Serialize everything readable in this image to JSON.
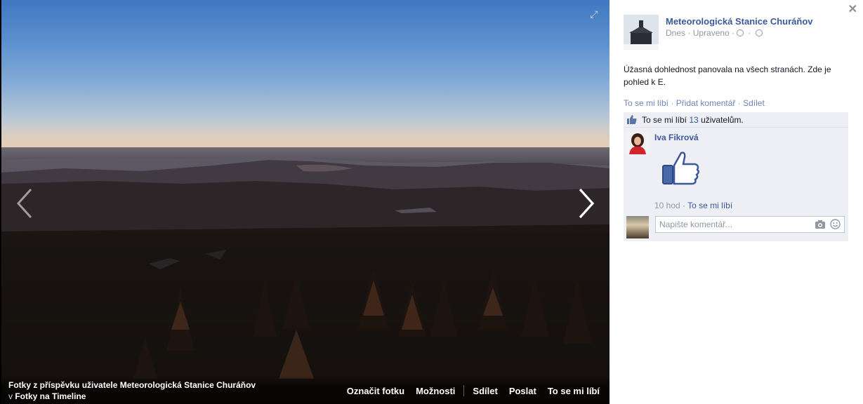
{
  "photo": {
    "caption_title": "Fotky z příspěvku uživatele Meteorologická Stanice Churáňov",
    "caption_prefix": "v",
    "caption_album": "Fotky na Timeline",
    "actions": [
      "Označit fotku",
      "Možnosti",
      "Sdílet",
      "Poslat",
      "To se mi líbí"
    ]
  },
  "post": {
    "page_name": "Meteorologická Stanice Churáňov",
    "meta_date": "Dnes",
    "meta_edited": "Upraveno",
    "text": "Úžasná dohlednost panovala na všech stranách. Zde je pohled k E.",
    "action_like": "To se mi líbí",
    "action_comment": "Přidat komentář",
    "action_share": "Sdílet",
    "likes_prefix": "To se mi líbí",
    "likes_count": "13",
    "likes_suffix": "uživatelům."
  },
  "comment": {
    "author": "Iva Fikrová",
    "time": "10 hod",
    "like_label": "To se mi líbí"
  },
  "composer": {
    "placeholder": "Napište komentář..."
  },
  "colors": {
    "link": "#3b5998",
    "ufi_bg": "#edeff4"
  }
}
